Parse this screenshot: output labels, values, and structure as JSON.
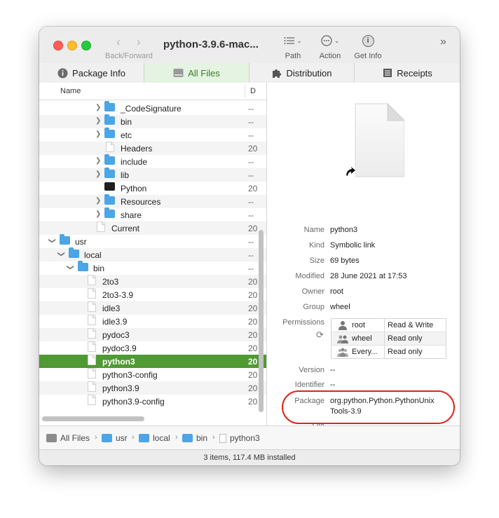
{
  "window": {
    "title": "python-3.9.6-mac...",
    "nav_label": "Back/Forward",
    "toolbar": [
      {
        "label": "Path",
        "icon": "list-icon"
      },
      {
        "label": "Action",
        "icon": "ellipsis-circle-icon"
      },
      {
        "label": "Get Info",
        "icon": "info-icon"
      }
    ]
  },
  "tabs": [
    {
      "label": "Package Info",
      "icon": "info-circle-icon"
    },
    {
      "label": "All Files",
      "icon": "disk-icon"
    },
    {
      "label": "Distribution",
      "icon": "puzzle-icon"
    },
    {
      "label": "Receipts",
      "icon": "receipt-icon"
    }
  ],
  "file_list": {
    "col_name": "Name",
    "col_date": "D",
    "rows": [
      {
        "name": "_CodeSignature",
        "date": "--"
      },
      {
        "name": "bin",
        "date": "--"
      },
      {
        "name": "etc",
        "date": "--"
      },
      {
        "name": "Headers",
        "date": "20"
      },
      {
        "name": "include",
        "date": "--"
      },
      {
        "name": "lib",
        "date": "--"
      },
      {
        "name": "Python",
        "date": "20"
      },
      {
        "name": "Resources",
        "date": "--"
      },
      {
        "name": "share",
        "date": "--"
      },
      {
        "name": "Current",
        "date": "20"
      },
      {
        "name": "usr",
        "date": "--"
      },
      {
        "name": "local",
        "date": "--"
      },
      {
        "name": "bin",
        "date": "--"
      },
      {
        "name": "2to3",
        "date": "20"
      },
      {
        "name": "2to3-3.9",
        "date": "20"
      },
      {
        "name": "idle3",
        "date": "20"
      },
      {
        "name": "idle3.9",
        "date": "20"
      },
      {
        "name": "pydoc3",
        "date": "20"
      },
      {
        "name": "pydoc3.9",
        "date": "20"
      },
      {
        "name": "python3",
        "date": "20"
      },
      {
        "name": "python3-config",
        "date": "20"
      },
      {
        "name": "python3.9",
        "date": "20"
      },
      {
        "name": "python3.9-config",
        "date": "20"
      }
    ]
  },
  "info": {
    "name_label": "Name",
    "name": "python3",
    "kind_label": "Kind",
    "kind": "Symbolic link",
    "size_label": "Size",
    "size": "69 bytes",
    "modified_label": "Modified",
    "modified": "28 June 2021 at 17:53",
    "owner_label": "Owner",
    "owner": "root",
    "group_label": "Group",
    "group": "wheel",
    "permissions_label": "Permissions",
    "permissions": [
      {
        "user": "root",
        "access": "Read & Write"
      },
      {
        "user": "wheel",
        "access": "Read only"
      },
      {
        "user": "Every...",
        "access": "Read only"
      }
    ],
    "version_label": "Version",
    "version": "--",
    "identifier_label": "Identifier",
    "identifier": "--",
    "package_label": "Package",
    "package_line1": "org.python.Python.PythonUnix",
    "package_line2": "Tools-3.9",
    "file_label": "File",
    "file": "--",
    "highlight_color": "#e2231a"
  },
  "pathbar": [
    "All Files",
    "usr",
    "local",
    "bin",
    "python3"
  ],
  "status": "3 items, 117.4 MB installed",
  "colors": {
    "selection": "#4f9a33",
    "active_tab": "#e5f3e2",
    "folder": "#4ba5e6"
  }
}
